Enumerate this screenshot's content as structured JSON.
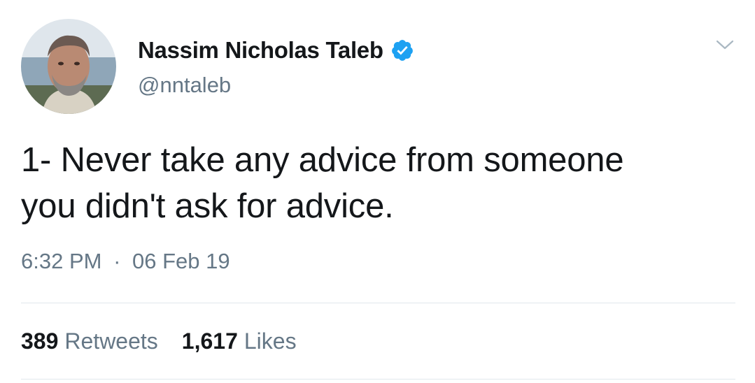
{
  "author": {
    "display_name": "Nassim Nicholas Taleb",
    "handle": "@nntaleb",
    "verified": true,
    "avatar_icon": "profile-photo"
  },
  "tweet": {
    "text_lines": [
      "1- Never take any advice from someone",
      "you didn't ask for advice."
    ],
    "time": "6:32 PM",
    "separator": "·",
    "date": "06 Feb 19"
  },
  "stats": {
    "retweets_count": "389",
    "retweets_label": "Retweets",
    "likes_count": "1,617",
    "likes_label": "Likes"
  },
  "icons": {
    "verified": "verified-badge-icon",
    "menu": "chevron-down-icon"
  },
  "colors": {
    "primary_text": "#14171a",
    "secondary_text": "#657786",
    "verified_blue": "#1da1f2",
    "divider": "#e1e8ed",
    "background": "#ffffff"
  }
}
